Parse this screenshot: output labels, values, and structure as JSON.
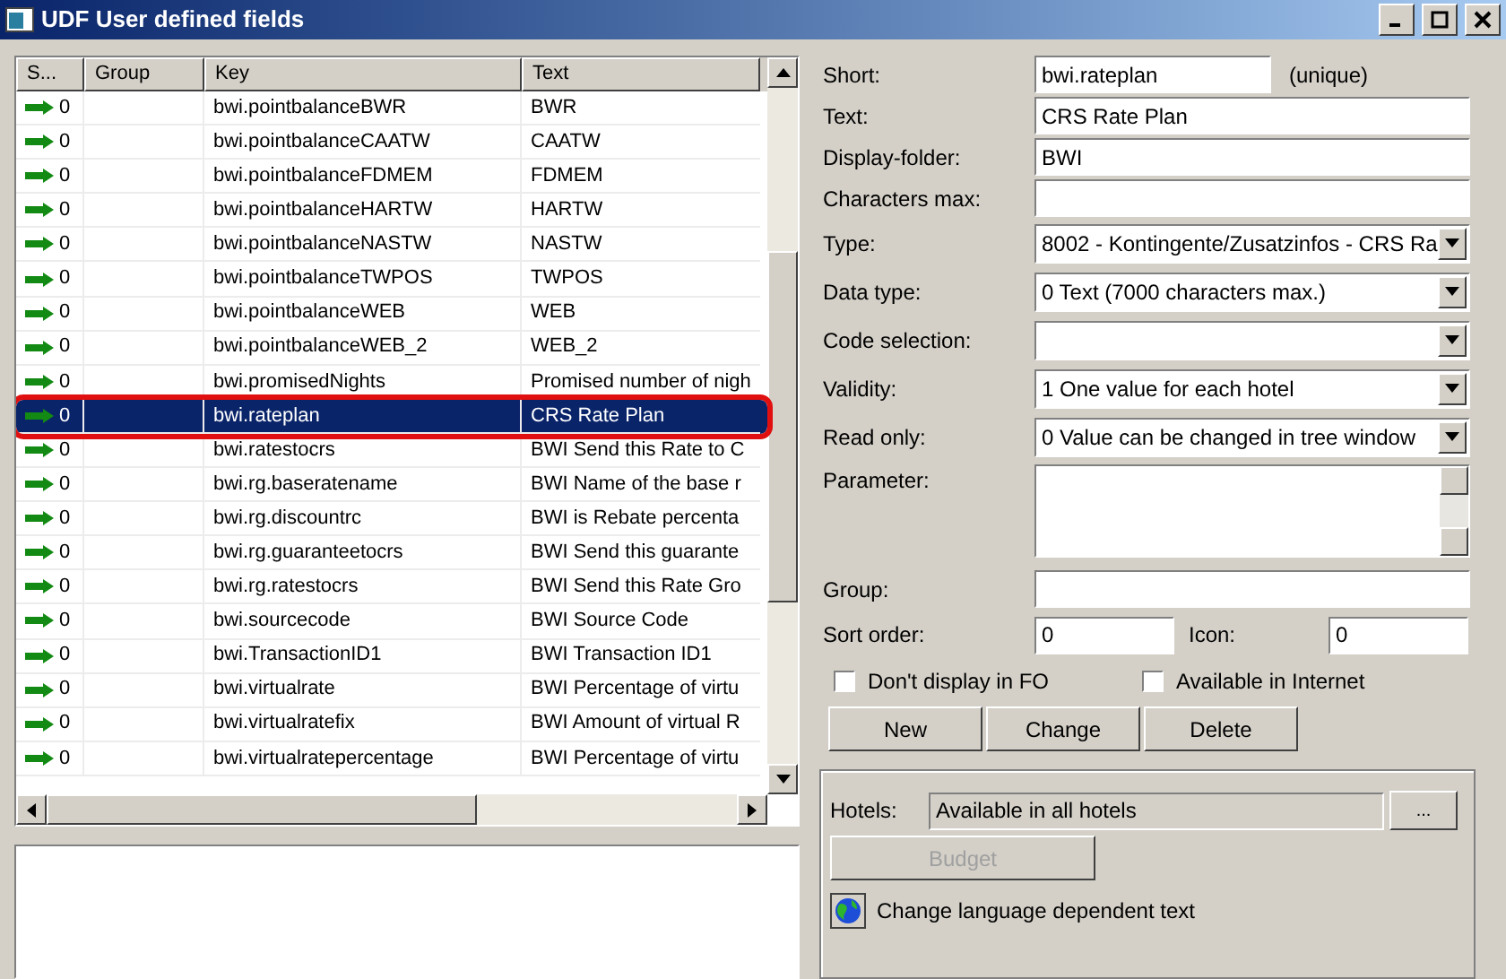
{
  "window": {
    "title": "UDF User defined fields"
  },
  "table": {
    "columns": [
      "S...",
      "Group",
      "Key",
      "Text"
    ],
    "rows": [
      {
        "status": "0",
        "group": "",
        "key": "bwi.pointbalanceBWR",
        "text": "BWR",
        "selected": false
      },
      {
        "status": "0",
        "group": "",
        "key": "bwi.pointbalanceCAATW",
        "text": "CAATW",
        "selected": false
      },
      {
        "status": "0",
        "group": "",
        "key": "bwi.pointbalanceFDMEM",
        "text": "FDMEM",
        "selected": false
      },
      {
        "status": "0",
        "group": "",
        "key": "bwi.pointbalanceHARTW",
        "text": "HARTW",
        "selected": false
      },
      {
        "status": "0",
        "group": "",
        "key": "bwi.pointbalanceNASTW",
        "text": "NASTW",
        "selected": false
      },
      {
        "status": "0",
        "group": "",
        "key": "bwi.pointbalanceTWPOS",
        "text": "TWPOS",
        "selected": false
      },
      {
        "status": "0",
        "group": "",
        "key": "bwi.pointbalanceWEB",
        "text": "WEB",
        "selected": false
      },
      {
        "status": "0",
        "group": "",
        "key": "bwi.pointbalanceWEB_2",
        "text": "WEB_2",
        "selected": false
      },
      {
        "status": "0",
        "group": "",
        "key": "bwi.promisedNights",
        "text": "Promised number of nigh",
        "selected": false
      },
      {
        "status": "0",
        "group": "",
        "key": "bwi.rateplan",
        "text": "CRS Rate Plan",
        "selected": true
      },
      {
        "status": "0",
        "group": "",
        "key": "bwi.ratestocrs",
        "text": "BWI Send this Rate to C",
        "selected": false
      },
      {
        "status": "0",
        "group": "",
        "key": "bwi.rg.baseratename",
        "text": "BWI Name of the base r",
        "selected": false
      },
      {
        "status": "0",
        "group": "",
        "key": "bwi.rg.discountrc",
        "text": "BWI is Rebate percenta",
        "selected": false
      },
      {
        "status": "0",
        "group": "",
        "key": "bwi.rg.guaranteetocrs",
        "text": "BWI Send this guarante",
        "selected": false
      },
      {
        "status": "0",
        "group": "",
        "key": "bwi.rg.ratestocrs",
        "text": "BWI Send this Rate Gro",
        "selected": false
      },
      {
        "status": "0",
        "group": "",
        "key": "bwi.sourcecode",
        "text": "BWI Source Code",
        "selected": false
      },
      {
        "status": "0",
        "group": "",
        "key": "bwi.TransactionID1",
        "text": "BWI Transaction ID1",
        "selected": false
      },
      {
        "status": "0",
        "group": "",
        "key": "bwi.virtualrate",
        "text": "BWI Percentage of virtu",
        "selected": false
      },
      {
        "status": "0",
        "group": "",
        "key": "bwi.virtualratefix",
        "text": "BWI Amount of virtual R",
        "selected": false
      },
      {
        "status": "0",
        "group": "",
        "key": "bwi.virtualratepercentage",
        "text": "BWI Percentage of virtu",
        "selected": false
      }
    ]
  },
  "form": {
    "fields": [
      {
        "kind": "text",
        "label": "Short:",
        "value": "bwi.rateplan",
        "note": "(unique)"
      },
      {
        "kind": "text",
        "label": "Text:",
        "value": "CRS Rate Plan"
      },
      {
        "kind": "text",
        "label": "Display-folder:",
        "value": "BWI"
      },
      {
        "kind": "text",
        "label": "Characters max:"
      },
      {
        "kind": "select",
        "label": "Type:",
        "value": "8002 - Kontingente/Zusatzinfos - CRS Ra"
      },
      {
        "kind": "select",
        "label": "Data type:",
        "value": "0 Text (7000 characters max.)"
      },
      {
        "kind": "select",
        "label": "Code selection:"
      },
      {
        "kind": "select",
        "label": "Validity:",
        "value": "1 One value for each hotel"
      },
      {
        "kind": "select",
        "label": "Read only:",
        "value": "0 Value can be changed in tree window"
      },
      {
        "kind": "memo",
        "label": "Parameter:"
      },
      {
        "kind": "text",
        "label": "Group:"
      }
    ],
    "sort_order": {
      "label": "Sort order:",
      "value": "0"
    },
    "icon": {
      "label": "Icon:",
      "value": "0"
    },
    "checkboxes": [
      {
        "label": "Don't display in FO",
        "checked": false
      },
      {
        "label": "Available in Internet",
        "checked": false
      }
    ],
    "buttons": [
      "New",
      "Change",
      "Delete"
    ],
    "hotels": {
      "label": "Hotels:",
      "value": "Available in all hotels",
      "browse": "..."
    },
    "budget": {
      "label": "Budget",
      "disabled": true
    },
    "language_link": "Change language dependent text"
  }
}
